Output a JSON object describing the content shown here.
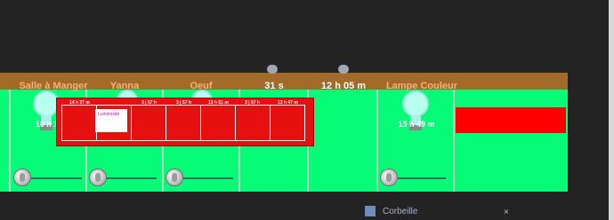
{
  "columns": [
    {
      "key": "col1",
      "title": "Salle à Manger",
      "time": "10 h 38",
      "title_color": "#f6b07a"
    },
    {
      "key": "col2",
      "title": "Yanna",
      "time": "",
      "title_color": "#f6b07a"
    },
    {
      "key": "col3",
      "title": "Oeuf",
      "time": "",
      "title_color": "#f6b07a"
    },
    {
      "key": "col4",
      "title": "31 s",
      "time": "",
      "title_color": "#ffffff"
    },
    {
      "key": "col5",
      "title": "12 h 05 m",
      "time": "",
      "title_color": "#ffffff"
    },
    {
      "key": "col6",
      "title": "Lampe Couleur",
      "time": "15 h 49 m",
      "title_color": "#f6b07a"
    }
  ],
  "popup": {
    "labels": [
      "14 h 37 m",
      "3 j 57 h",
      "3 j 57 h",
      "13 h 51 m",
      "3 j 57 h",
      "13 h 47 m"
    ],
    "thumbnail_text": "Luminosité"
  },
  "bottom": {
    "text": "Corbeille"
  },
  "colors": {
    "background": "#232323",
    "header": "#a36b2a",
    "grid": "#06fb77",
    "accent_red": "#ff0000",
    "title": "#f6b07a"
  }
}
